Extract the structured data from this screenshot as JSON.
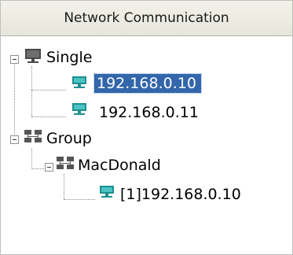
{
  "header": {
    "title": "Network Communication"
  },
  "tree": {
    "single": {
      "label": "Single",
      "children": [
        {
          "label": "192.168.0.10",
          "selected": true
        },
        {
          "label": "192.168.0.11",
          "selected": false
        }
      ]
    },
    "group": {
      "label": "Group",
      "children": [
        {
          "label": "MacDonald",
          "children": [
            {
              "label": "[1]192.168.0.10"
            }
          ]
        }
      ]
    }
  },
  "colors": {
    "selection": "#3366aa",
    "header_bg": "#ebebe1",
    "device_icon": "#1e8f8f"
  },
  "icons": {
    "expander": "minus-box-icon",
    "category_single": "computer-icon",
    "category_group": "computer-group-icon",
    "device": "network-device-icon"
  }
}
